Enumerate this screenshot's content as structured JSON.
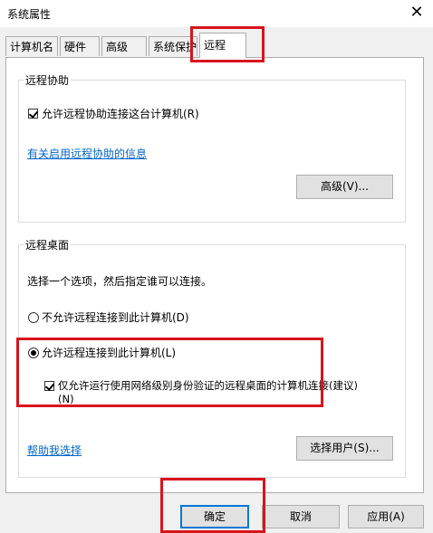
{
  "window": {
    "title": "系统属性",
    "close_glyph": "✕"
  },
  "tabs": [
    {
      "label": "计算机名"
    },
    {
      "label": "硬件"
    },
    {
      "label": "高级"
    },
    {
      "label": "系统保护"
    },
    {
      "label": "远程",
      "active": true
    }
  ],
  "remote_assistance": {
    "group_title": "远程协助",
    "allow_checkbox_label": "允许远程协助连接这台计算机(R)",
    "allow_checked": true,
    "info_link": "有关启用远程协助的信息",
    "advanced_button": "高级(V)..."
  },
  "remote_desktop": {
    "group_title": "远程桌面",
    "instruction": "选择一个选项，然后指定谁可以连接。",
    "option_deny": "不允许远程连接到此计算机(D)",
    "option_allow": "允许远程连接到此计算机(L)",
    "selected_option": "allow",
    "nla_checkbox_line1": "仅允许运行使用网络级别身份验证的远程桌面的计算机连接(建议)",
    "nla_checkbox_line2": "(N)",
    "nla_checked": true,
    "help_link": "帮助我选择",
    "select_users_button": "选择用户(S)..."
  },
  "footer": {
    "ok_button": "确定",
    "cancel_button": "取消",
    "apply_button": "应用(A)"
  },
  "colors": {
    "highlight_box": "#d8141c",
    "link": "#0066cc",
    "default_button_border": "#0078d7"
  }
}
